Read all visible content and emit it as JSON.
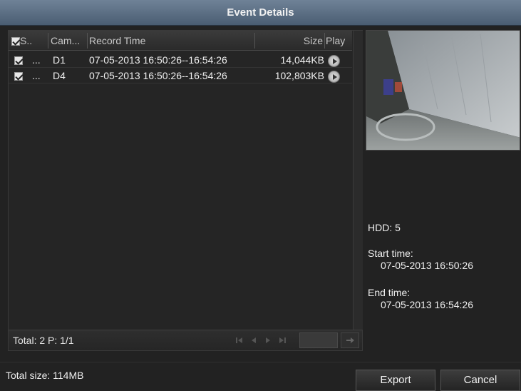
{
  "window": {
    "title": "Event Details"
  },
  "table": {
    "headers": {
      "select": "S...",
      "camera": "Cam...",
      "record_time": "Record Time",
      "size": "Size",
      "play": "Play"
    },
    "rows": [
      {
        "select": "...",
        "camera": "D1",
        "record_time": "07-05-2013 16:50:26--16:54:26",
        "size": "14,044KB",
        "checked": true
      },
      {
        "select": "...",
        "camera": "D4",
        "record_time": "07-05-2013 16:50:26--16:54:26",
        "size": "102,803KB",
        "checked": true
      }
    ]
  },
  "pager": {
    "total_label": "Total: 2  P: 1/1",
    "page_input": ""
  },
  "info": {
    "hdd": "HDD: 5",
    "start_label": "Start time:",
    "start_value": "07-05-2013 16:50:26",
    "end_label": "End time:",
    "end_value": "07-05-2013 16:54:26"
  },
  "footer": {
    "total_size": "Total size: 114MB",
    "export_label": "Export",
    "cancel_label": "Cancel"
  },
  "icons": {
    "checkbox": "checkbox-icon",
    "play": "play-circle-icon",
    "first": "first-page-icon",
    "prev": "prev-page-icon",
    "next": "next-page-icon",
    "last": "last-page-icon",
    "go": "go-arrow-icon"
  },
  "colors": {
    "titlebar": "#5a6d82",
    "background": "#222222"
  }
}
